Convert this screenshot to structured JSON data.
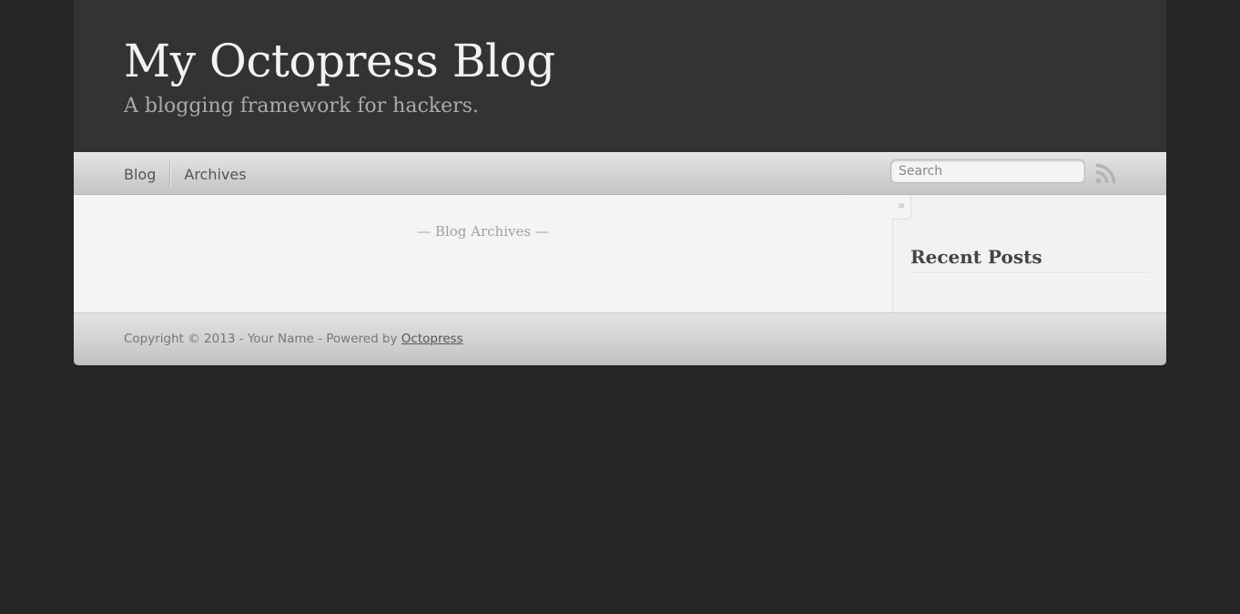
{
  "header": {
    "title": "My Octopress Blog",
    "subtitle": "A blogging framework for hackers."
  },
  "nav": {
    "items": [
      {
        "label": "Blog"
      },
      {
        "label": "Archives"
      }
    ],
    "search_placeholder": "Search",
    "rss_icon": "rss-icon"
  },
  "main": {
    "heading": "— Blog Archives —"
  },
  "sidebar": {
    "toggle_glyph": "»",
    "heading": "Recent Posts"
  },
  "footer": {
    "text": "Copyright © 2013 - Your Name - Powered by ",
    "link_label": "Octopress"
  },
  "colors": {
    "page_background": "#252525",
    "header_background": "#333333",
    "title_color": "#f2f2f2"
  }
}
